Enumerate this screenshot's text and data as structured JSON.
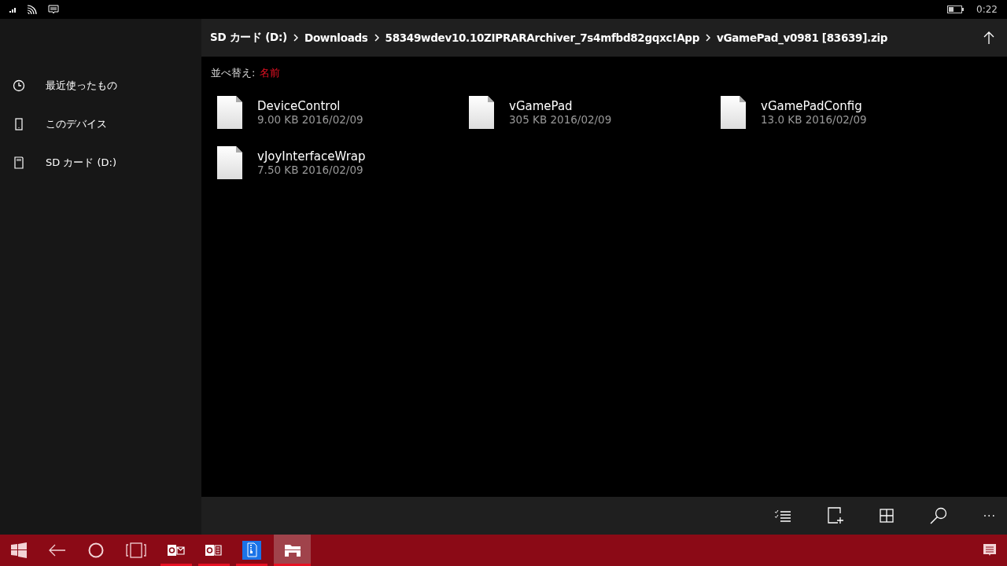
{
  "status_bar": {
    "time": "0:22"
  },
  "sidebar": {
    "items": [
      {
        "kind": "recent",
        "label": "最近使ったもの"
      },
      {
        "kind": "device",
        "label": "このデバイス"
      },
      {
        "kind": "sdcard",
        "label": "SD カード (D:)"
      }
    ]
  },
  "breadcrumb": [
    "SD カード (D:)",
    "Downloads",
    "58349wdev10.10ZIPRARArchiver_7s4mfbd82gqxc!App",
    "vGamePad_v0981 [83639].zip"
  ],
  "sort": {
    "label": "並べ替え:",
    "value": "名前"
  },
  "files": [
    {
      "name": "DeviceControl",
      "size": "9.00 KB",
      "date": "2016/02/09"
    },
    {
      "name": "vGamePad",
      "size": "305 KB",
      "date": "2016/02/09"
    },
    {
      "name": "vGamePadConfig",
      "size": "13.0 KB",
      "date": "2016/02/09"
    },
    {
      "name": "vJoyInterfaceWrap",
      "size": "7.50 KB",
      "date": "2016/02/09"
    }
  ],
  "command_bar": {
    "more": "···"
  },
  "taskbar": {
    "apps": [
      {
        "kind": "outlook-mail",
        "running": true,
        "selected": false
      },
      {
        "kind": "office",
        "running": true,
        "selected": false
      },
      {
        "kind": "zip",
        "running": true,
        "selected": false
      },
      {
        "kind": "explorer",
        "running": true,
        "selected": true
      }
    ]
  }
}
